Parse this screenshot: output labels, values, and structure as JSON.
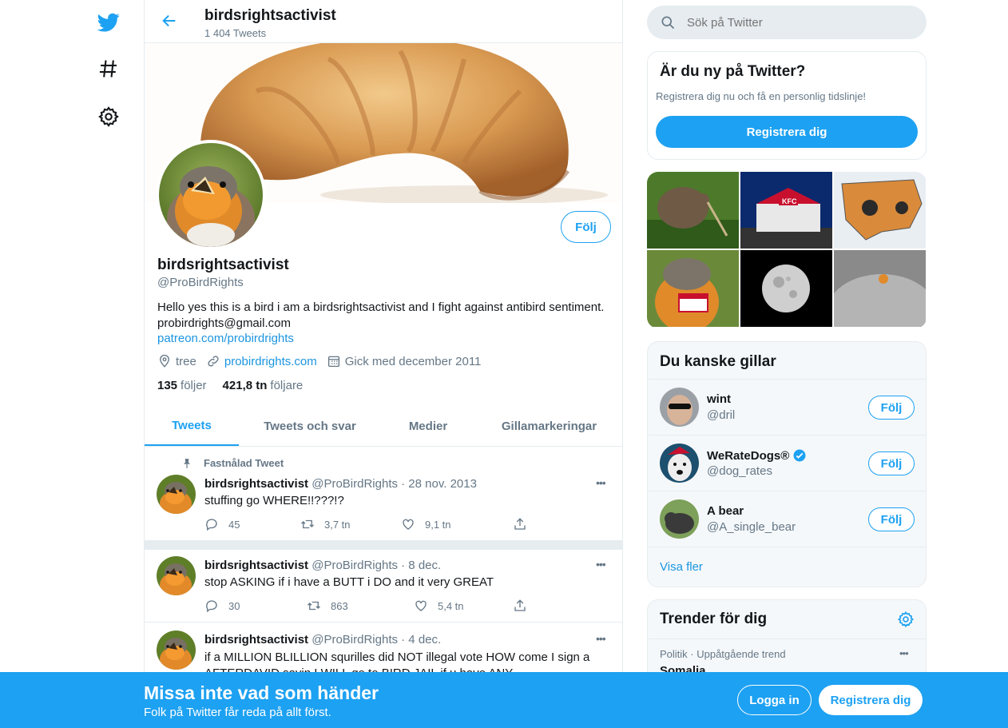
{
  "nav": {
    "logo_icon": "twitter-bird-icon",
    "explore_icon": "hashtag-icon",
    "settings_icon": "gear-icon"
  },
  "header": {
    "name": "birdsrightsactivist",
    "tweet_count": "1 404 Tweets"
  },
  "profile": {
    "follow_label": "Följ",
    "name": "birdsrightsactivist",
    "handle": "@ProBirdRights",
    "bio_line1": "Hello yes this is a bird i am a birdsrightsactivist and I fight against antibird sentiment.",
    "bio_line2": "probirdrights@gmail.com",
    "bio_link": "patreon.com/probirdrights",
    "location": "tree",
    "website": "probirdrights.com",
    "joined": "Gick med december 2011",
    "following_count": "135",
    "following_label": "följer",
    "followers_count": "421,8 tn",
    "followers_label": "följare"
  },
  "tabs": [
    {
      "label": "Tweets",
      "active": true
    },
    {
      "label": "Tweets och svar",
      "active": false
    },
    {
      "label": "Medier",
      "active": false
    },
    {
      "label": "Gillamarkeringar",
      "active": false
    }
  ],
  "pinned_label": "Fastnålad Tweet",
  "tweets": [
    {
      "name": "birdsrightsactivist",
      "meta": "@ProBirdRights · 28 nov. 2013",
      "text": "stuffing go WHERE!!???!?",
      "replies": "45",
      "retweets": "3,7 tn",
      "likes": "9,1 tn",
      "more": "•••"
    },
    {
      "name": "birdsrightsactivist",
      "meta": "@ProBirdRights · 8 dec.",
      "text": "stop ASKING if i have a BUTT i DO and it very GREAT",
      "replies": "30",
      "retweets": "863",
      "likes": "5,4 tn",
      "more": "•••"
    },
    {
      "name": "birdsrightsactivist",
      "meta": "@ProBirdRights · 4 dec.",
      "text": "if a MILLION BLILLION squrilles did NOT illegal vote HOW come I sign a AFTERDAVID sayin I WILL go to BIRD JAIL if u have ANY",
      "more": "•••"
    }
  ],
  "search": {
    "placeholder": "Sök på Twitter"
  },
  "signup_card": {
    "title": "Är du ny på Twitter?",
    "text": "Registrera dig nu och få en personlig tidslinje!",
    "button": "Registrera dig"
  },
  "who_to_follow": {
    "title": "Du kanske gillar",
    "follow_label": "Följ",
    "users": [
      {
        "name": "wint",
        "handle": "@dril",
        "verified": false
      },
      {
        "name": "WeRateDogs®",
        "handle": "@dog_rates",
        "verified": true
      },
      {
        "name": "A bear",
        "handle": "@A_single_bear",
        "verified": false
      }
    ],
    "show_more": "Visa fler"
  },
  "trends": {
    "title": "Trender för dig",
    "items": [
      {
        "context": "Politik · Uppåtgående trend",
        "name": "Somalia",
        "more": "•••"
      }
    ]
  },
  "bottom_bar": {
    "title": "Missa inte vad som händer",
    "subtitle": "Folk på Twitter får reda på allt först.",
    "login": "Logga in",
    "register": "Registrera dig"
  },
  "colors": {
    "accent": "#1da1f2",
    "border": "#e6ecf0",
    "muted": "#657786"
  }
}
